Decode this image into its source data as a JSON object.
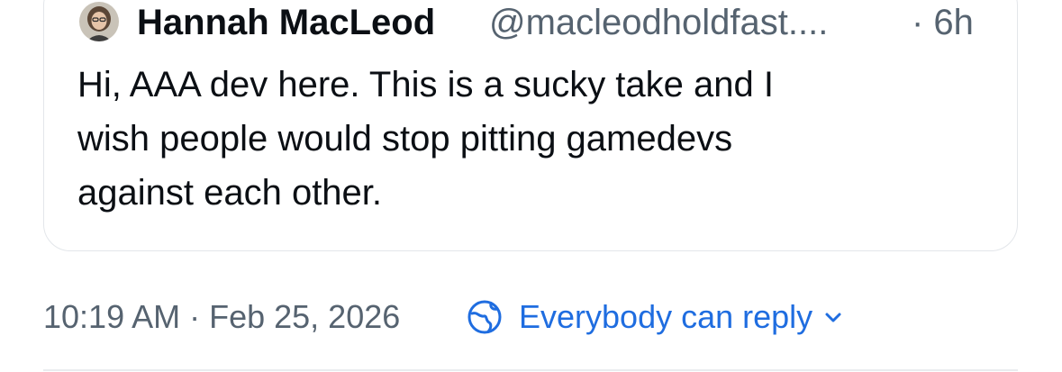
{
  "quoted_post": {
    "author_name": "Hannah MacLeod",
    "author_handle": "@macleodholdfast....",
    "age": "· 6h",
    "text_lines": [
      "Hi, AAA dev here. This is a sucky take and I",
      "wish people would stop pitting gamedevs",
      "against each other."
    ],
    "avatar_icon": "avatar-photo-icon"
  },
  "post_meta": {
    "timestamp": "10:19 AM · Feb 25, 2026",
    "reply_setting_label": "Everybody can reply",
    "reply_icon": "globe-icon",
    "dropdown_icon": "chevron-down-icon"
  },
  "colors": {
    "text_primary": "#0b0f14",
    "text_secondary": "#566370",
    "accent": "#1f6de0",
    "border": "#e3e6ea"
  }
}
